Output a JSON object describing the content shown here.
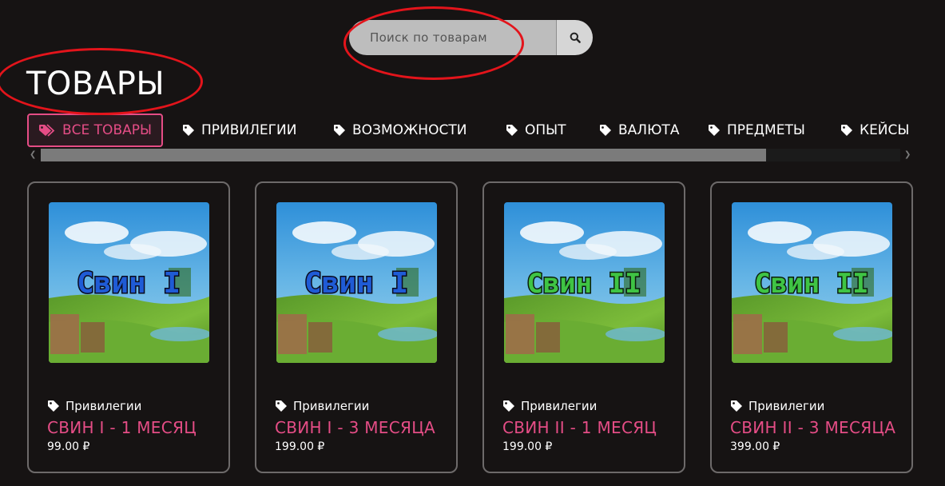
{
  "search": {
    "placeholder": "Поиск по товарам",
    "icon": "search-icon"
  },
  "page_title": "ТОВАРЫ",
  "tabs": [
    {
      "label": "ВСЕ ТОВАРЫ",
      "icon": "tags-icon",
      "active": true
    },
    {
      "label": "ПРИВИЛЕГИИ",
      "icon": "tag-icon"
    },
    {
      "label": "ВОЗМОЖНОСТИ",
      "icon": "tag-icon"
    },
    {
      "label": "ОПЫТ",
      "icon": "tag-icon"
    },
    {
      "label": "ВАЛЮТА",
      "icon": "tag-icon"
    },
    {
      "label": "ПРЕДМЕТЫ",
      "icon": "tag-icon"
    },
    {
      "label": "КЕЙСЫ",
      "icon": "tag-icon"
    }
  ],
  "products": [
    {
      "category": "Привилегии",
      "name": "СВИН I - 1 МЕСЯЦ",
      "price": "99.00 ₽",
      "image_text": "Свин I",
      "image_text_color": "#1f5bd6"
    },
    {
      "category": "Привилегии",
      "name": "СВИН I - 3 МЕСЯЦА",
      "price": "199.00 ₽",
      "image_text": "Свин I",
      "image_text_color": "#1f5bd6"
    },
    {
      "category": "Привилегии",
      "name": "СВИН II - 1 МЕСЯЦ",
      "price": "199.00 ₽",
      "image_text": "Свин II",
      "image_text_color": "#3fc444"
    },
    {
      "category": "Привилегии",
      "name": "СВИН II - 3 МЕСЯЦА",
      "price": "399.00 ₽",
      "image_text": "Свин II",
      "image_text_color": "#3fc444"
    }
  ],
  "colors": {
    "accent": "#e54d86",
    "background": "#161313",
    "annotation": "#e3141b"
  }
}
